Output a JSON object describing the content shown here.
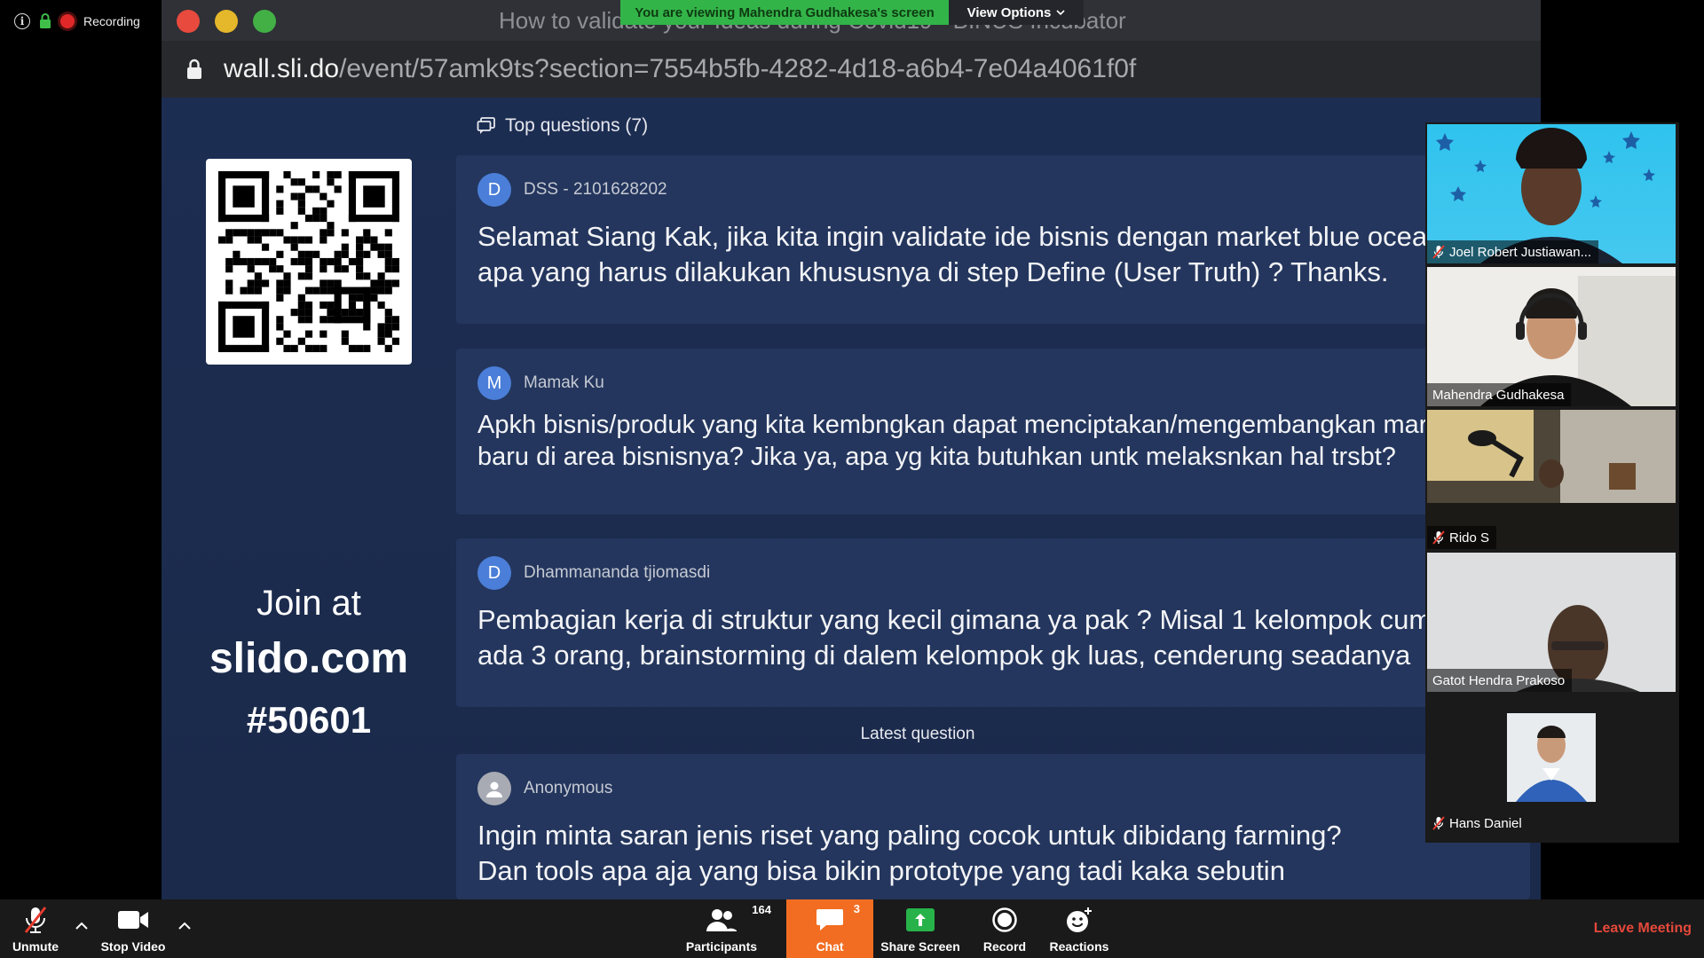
{
  "status": {
    "recording_label": "Recording"
  },
  "banner": {
    "viewing_text": "You are viewing Mahendra Gudhakesa's screen",
    "view_options_label": "View Options"
  },
  "browser": {
    "window_title": "How to validate your Ideas during Covid19 - BINUS Incubator",
    "url_domain": "wall.sli.do",
    "url_path": "/event/57amk9ts?section=7554b5fb-4282-4d18-a6b4-7e04a4061f0f"
  },
  "slido": {
    "join_label": "Join at",
    "join_site": "slido.com",
    "join_code": "#50601",
    "top_questions_label": "Top questions (7)",
    "latest_label": "Latest question",
    "questions": [
      {
        "initial": "D",
        "author": "DSS - 2101628202",
        "text": "Selamat Siang Kak, jika kita ingin validate ide bisnis dengan market blue ocean,\napa yang harus dilakukan khususnya di step Define (User Truth) ? Thanks."
      },
      {
        "initial": "M",
        "author": "Mamak Ku",
        "text": "Apkh bisnis/produk yang kita kembngkan dapat menciptakan/mengembangkan market\nbaru di area bisnisnya? Jika ya, apa yg kita butuhkan untk melaksnkan hal trsbt?"
      },
      {
        "initial": "D",
        "author": "Dhammananda tjiomasdi",
        "text": "Pembagian kerja di struktur yang kecil gimana ya pak ? Misal 1 kelompok cuma\nada 3 orang, brainstorming di dalem kelompok gk luas, cenderung seadanya"
      },
      {
        "initial": "",
        "author": "Anonymous",
        "text": "Ingin minta saran jenis riset yang paling cocok untuk dibidang farming?\nDan tools apa aja yang bisa bikin prototype yang tadi kaka sebutin"
      }
    ]
  },
  "participants_gallery": [
    {
      "name": "Joel Robert Justiawan...",
      "muted": true,
      "active": false
    },
    {
      "name": "Mahendra Gudhakesa",
      "muted": false,
      "active": true
    },
    {
      "name": "Rido S",
      "muted": true,
      "active": false
    },
    {
      "name": "Gatot Hendra Prakoso",
      "muted": false,
      "active": false
    },
    {
      "name": "Hans Daniel",
      "muted": true,
      "active": false
    }
  ],
  "toolbar": {
    "unmute_label": "Unmute",
    "stop_video_label": "Stop Video",
    "participants_label": "Participants",
    "participants_count": "164",
    "chat_label": "Chat",
    "chat_badge": "3",
    "share_screen_label": "Share Screen",
    "record_label": "Record",
    "reactions_label": "Reactions",
    "leave_label": "Leave Meeting"
  },
  "colors": {
    "chat_active": "#f26d21",
    "sharing_banner": "#33b449",
    "leave": "#e5483b",
    "slido_bg": "#1c2d52"
  }
}
